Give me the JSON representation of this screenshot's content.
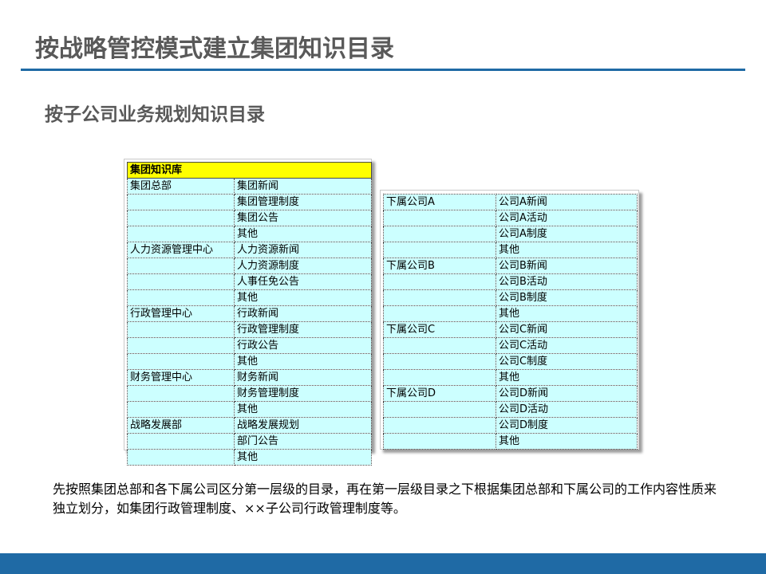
{
  "title": "按战略管控模式建立集团知识目录",
  "subtitle": "按子公司业务规划知识目录",
  "left_table": {
    "header": "集团知识库",
    "rows": [
      [
        "集团总部",
        "集团新闻"
      ],
      [
        "",
        "集团管理制度"
      ],
      [
        "",
        "集团公告"
      ],
      [
        "",
        "其他"
      ],
      [
        "人力资源管理中心",
        "人力资源新闻"
      ],
      [
        "",
        "人力资源制度"
      ],
      [
        "",
        "人事任免公告"
      ],
      [
        "",
        "其他"
      ],
      [
        "行政管理中心",
        "行政新闻"
      ],
      [
        "",
        "行政管理制度"
      ],
      [
        "",
        "行政公告"
      ],
      [
        "",
        "其他"
      ],
      [
        "财务管理中心",
        "财务新闻"
      ],
      [
        "",
        "财务管理制度"
      ],
      [
        "",
        "其他"
      ],
      [
        "战略发展部",
        "战略发展规划"
      ],
      [
        "",
        "部门公告"
      ],
      [
        "",
        "其他"
      ]
    ]
  },
  "right_table": {
    "rows": [
      [
        "下属公司A",
        "公司A新闻"
      ],
      [
        "",
        "公司A活动"
      ],
      [
        "",
        "公司A制度"
      ],
      [
        "",
        "其他"
      ],
      [
        "下属公司B",
        "公司B新闻"
      ],
      [
        "",
        "公司B活动"
      ],
      [
        "",
        "公司B制度"
      ],
      [
        "",
        "其他"
      ],
      [
        "下属公司C",
        "公司C新闻"
      ],
      [
        "",
        "公司C活动"
      ],
      [
        "",
        "公司C制度"
      ],
      [
        "",
        "其他"
      ],
      [
        "下属公司D",
        "公司D新闻"
      ],
      [
        "",
        "公司D活动"
      ],
      [
        "",
        "公司D制度"
      ],
      [
        "",
        "其他"
      ]
    ]
  },
  "note": "先按照集团总部和各下属公司区分第一层级的目录，再在第一层级目录之下根据集团总部和下属公司的工作内容性质来独立划分，如集团行政管理制度、××子公司行政管理制度等。",
  "colors": {
    "accent": "#1f6aa5",
    "cell_bg": "#ccffff",
    "header_bg": "#ffff00",
    "title_text": "#595959"
  }
}
